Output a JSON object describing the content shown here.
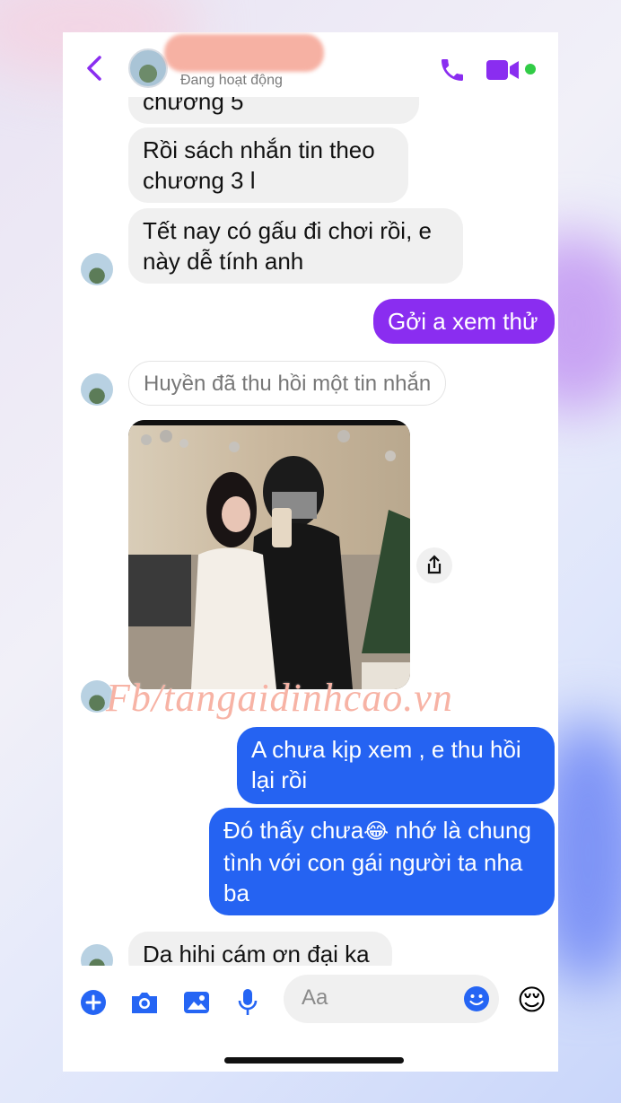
{
  "header": {
    "status": "Đang hoạt động",
    "colors": {
      "accent": "#8a2df0",
      "online": "#31cc46"
    }
  },
  "messages": {
    "m1": "chương 5",
    "m2": "Rồi sách nhắn tin theo chương 3 l",
    "m3": "Tết nay có gấu đi chơi rồi, e này dễ tính anh",
    "m4": "Gởi a xem thử",
    "recall": "Huyền đã thu hồi một tin nhắn",
    "m5": "A chưa kịp xem , e thu hồi lại rồi",
    "m6_a": "Đó thấy chưa",
    "m6_emoji": "😂",
    "m6_b": " nhớ là chung tình với con gái người ta nha ba",
    "m7": "Da hihi cám ơn đại ka"
  },
  "watermark": "Fb/tangaidinhcao.vn",
  "composer": {
    "placeholder": "Aa",
    "reaction_emoji": "😌",
    "icons": [
      "add-icon",
      "camera-icon",
      "gallery-icon",
      "microphone-icon",
      "emoji-icon"
    ]
  },
  "colors": {
    "purple_bubble": "#8a2df0",
    "blue_bubble": "#2563f2",
    "incoming_bubble": "#f0f0f0"
  }
}
